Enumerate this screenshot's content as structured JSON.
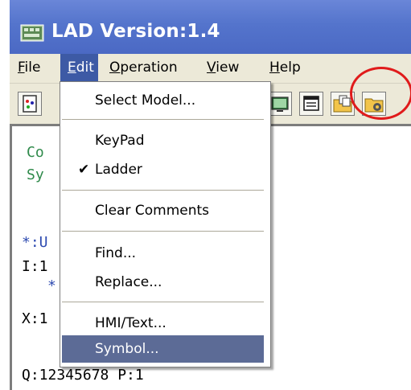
{
  "window": {
    "title": "LAD Version:1.4"
  },
  "menubar": {
    "items": [
      {
        "label": "File",
        "name": "menu-file",
        "active": false
      },
      {
        "label": "Edit",
        "name": "menu-edit",
        "active": true
      },
      {
        "label": "Operation",
        "name": "menu-operation",
        "active": false
      },
      {
        "label": "View",
        "name": "menu-view",
        "active": false
      },
      {
        "label": "Help",
        "name": "menu-help",
        "active": false
      }
    ]
  },
  "toolbar": {
    "buttons": [
      "new-file-icon",
      "monitor-icon",
      "window-icon",
      "copy-folder-icon",
      "folder-settings-icon"
    ],
    "highlighted": "folder-settings-icon",
    "highlight_color": "#e01b1b"
  },
  "editor": {
    "lines": {
      "comment_prefix": "Co",
      "symbol_prefix": "Sy",
      "label_prefix": "*:U",
      "input_prefix": "I:1",
      "star_fragment": "*",
      "x_prefix": "X:1",
      "q_line": "Q:12345678 P:1"
    }
  },
  "edit_menu": {
    "items": [
      {
        "label": "Select Model...",
        "checked": false
      },
      {
        "label": "KeyPad",
        "checked": false
      },
      {
        "label": "Ladder",
        "checked": true
      },
      {
        "label": "Clear Comments",
        "checked": false
      },
      {
        "label": "Find...",
        "checked": false
      },
      {
        "label": "Replace...",
        "checked": false
      },
      {
        "label": "HMI/Text...",
        "checked": false
      },
      {
        "label": "Symbol...",
        "checked": false,
        "highlighted": true
      }
    ],
    "check_glyph": "✔"
  }
}
